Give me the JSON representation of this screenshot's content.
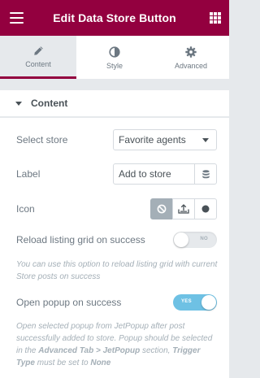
{
  "header": {
    "title": "Edit Data Store Button",
    "menu_icon": "hamburger-icon",
    "apps_icon": "grid-icon",
    "color": "#93003f"
  },
  "tabs": [
    {
      "label": "Content",
      "icon": "pencil-icon",
      "active": true
    },
    {
      "label": "Style",
      "icon": "half-circle-icon",
      "active": false
    },
    {
      "label": "Advanced",
      "icon": "gear-icon",
      "active": false
    }
  ],
  "section": {
    "title": "Content",
    "expanded": true
  },
  "controls": {
    "select_store": {
      "label": "Select store",
      "value": "Favorite agents"
    },
    "label": {
      "label": "Label",
      "value": "Add to store",
      "dynamic_icon": "database-icon"
    },
    "icon": {
      "label": "Icon",
      "options": [
        "ban-icon",
        "upload-icon",
        "circle-icon"
      ],
      "selected": 0
    },
    "reload_grid": {
      "label": "Reload listing grid on success",
      "toggle_text": "NO",
      "enabled": false,
      "description": "You can use this option to reload listing grid with current Store posts on success"
    },
    "open_popup": {
      "label": "Open popup on success",
      "toggle_text": "YES",
      "enabled": true,
      "description_parts": {
        "p1": "Open selected popup from JetPopup after post successfully added to store. Popup should be selected in the ",
        "b1": "Advanced Tab > JetPopup",
        "p2": " section, ",
        "b2": "Trigger Type",
        "p3": " must be set to ",
        "b3": "None"
      }
    }
  }
}
